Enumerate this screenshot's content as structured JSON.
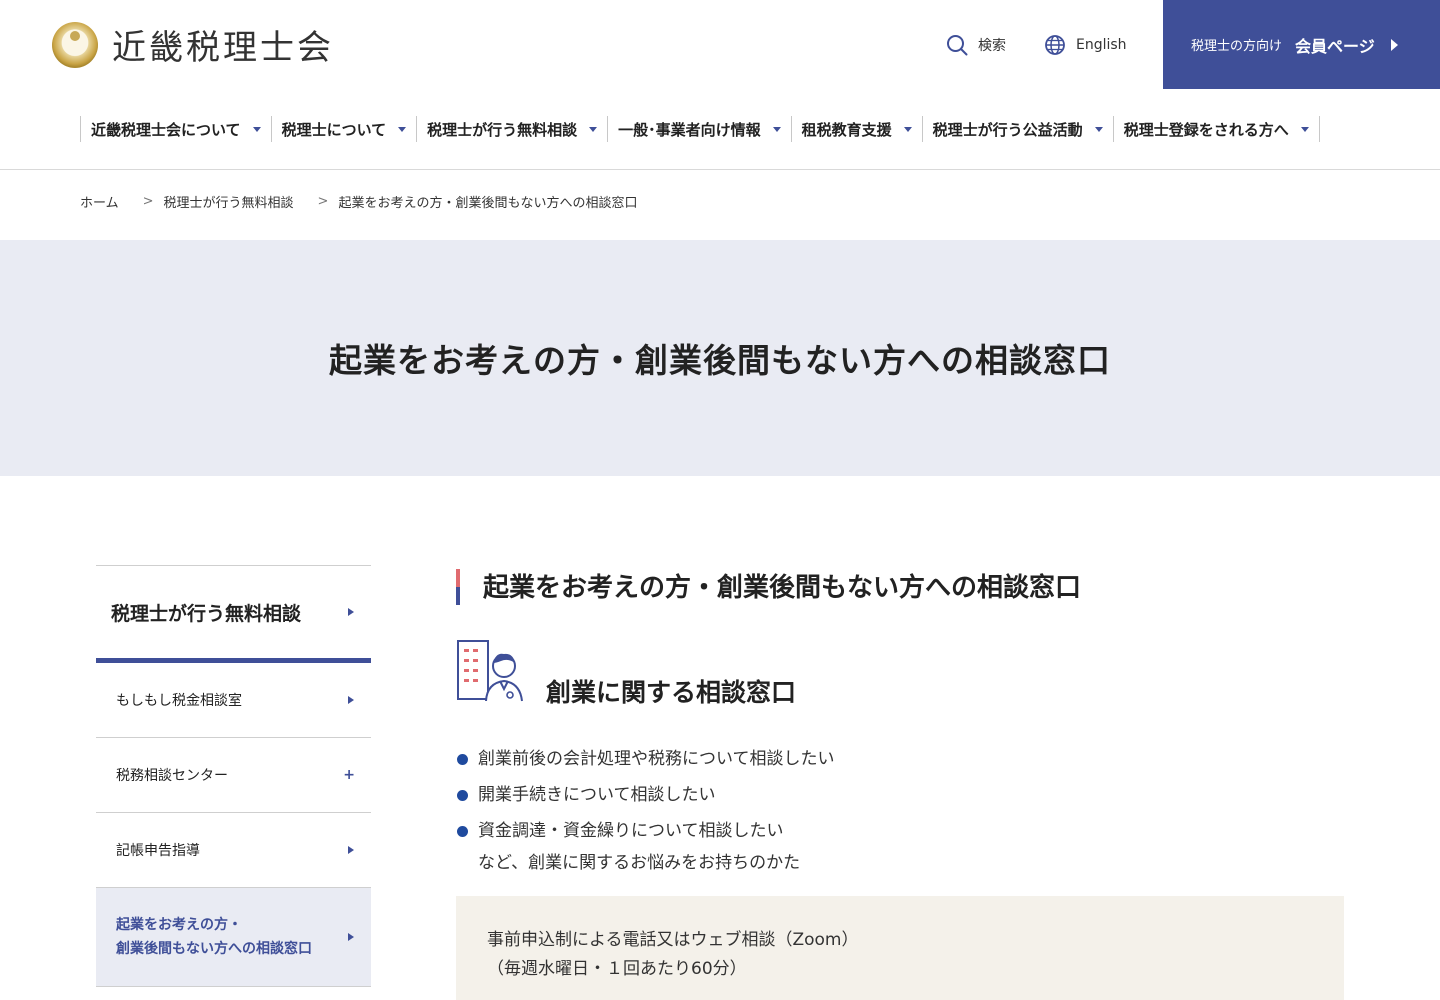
{
  "header": {
    "logo_text": "近畿税理士会",
    "search_label": "検索",
    "english_label": "English",
    "member": {
      "small_label": "税理士の方向け",
      "big_label": "会員ページ"
    }
  },
  "nav": {
    "items": [
      "近畿税理士会について",
      "税理士について",
      "税理士が行う無料相談",
      "一般･事業者向け情報",
      "租税教育支援",
      "税理士が行う公益活動",
      "税理士登録をされる方へ"
    ]
  },
  "breadcrumb": {
    "items": [
      "ホーム",
      "税理士が行う無料相談",
      "起業をお考えの方・創業後間もない方への相談窓口"
    ]
  },
  "hero": {
    "title": "起業をお考えの方・創業後間もない方への相談窓口"
  },
  "sidebar": {
    "heading": "税理士が行う無料相談",
    "items": [
      {
        "label": "もしもし税金相談室"
      },
      {
        "label": "税務相談センター"
      },
      {
        "label": "記帳申告指導"
      },
      {
        "label_line1": "起業をお考えの方・",
        "label_line2": "創業後間もない方への相談窓口"
      }
    ]
  },
  "main": {
    "section_title": "起業をお考えの方・創業後間もない方への相談窓口",
    "sub_title": "創業に関する相談窓口",
    "checklist": [
      "創業前後の会計処理や税務について相談したい",
      "開業手続きについて相談したい",
      "資金調達・資金繰りについて相談したい"
    ],
    "list_note": "など、創業に関するお悩みをお持ちのかた",
    "info": {
      "line1": "事前申込制による電話又はウェブ相談（Zoom）",
      "line2": "（毎週水曜日・１回あたり60分）"
    }
  },
  "colors": {
    "brand_navy": "#3f4f98",
    "accent_red": "#e06b6f",
    "hero_bg": "#e9ebf3",
    "info_bg": "#f4f1ea",
    "bullet_blue": "#1f4a9e"
  }
}
